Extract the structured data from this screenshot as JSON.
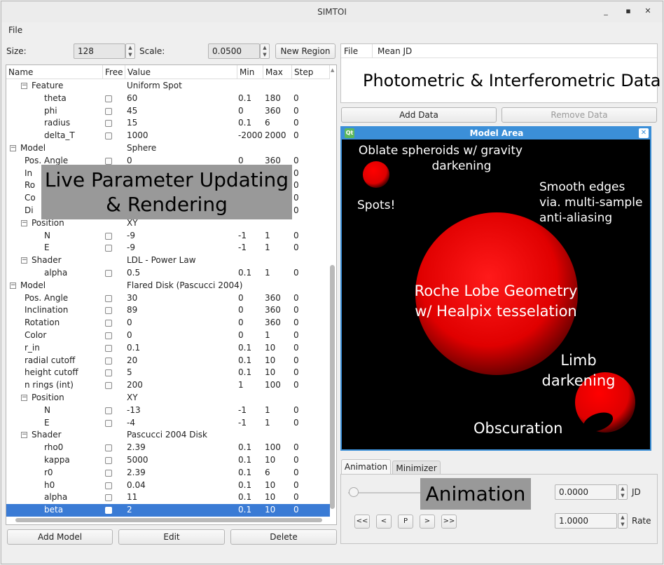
{
  "window": {
    "title": "SIMTOI"
  },
  "menu": {
    "file": "File"
  },
  "toolbar": {
    "size_label": "Size:",
    "size_value": "128",
    "scale_label": "Scale:",
    "scale_value": "0.0500",
    "new_region": "New Region"
  },
  "tree": {
    "headers": [
      "Name",
      "Free",
      "Value",
      "Min",
      "Max",
      "Step"
    ],
    "rows": [
      {
        "indent": 1,
        "exp": "−",
        "name": "Feature",
        "value": "Uniform Spot",
        "free": false,
        "min": "",
        "max": "",
        "step": ""
      },
      {
        "indent": 2,
        "name": "theta",
        "free": true,
        "value": "60",
        "min": "0.1",
        "max": "180",
        "step": "0"
      },
      {
        "indent": 2,
        "name": "phi",
        "free": true,
        "value": "45",
        "min": "0",
        "max": "360",
        "step": "0"
      },
      {
        "indent": 2,
        "name": "radius",
        "free": true,
        "value": "15",
        "min": "0.1",
        "max": "6",
        "step": "0"
      },
      {
        "indent": 2,
        "name": "delta_T",
        "free": true,
        "value": "1000",
        "min": "-2000",
        "max": "2000",
        "step": "0"
      },
      {
        "indent": 0,
        "exp": "−",
        "name": "Model",
        "value": "Sphere",
        "free": false,
        "min": "",
        "max": "",
        "step": ""
      },
      {
        "indent": 1,
        "name": "Pos. Angle",
        "free": true,
        "value": "0",
        "min": "0",
        "max": "360",
        "step": "0"
      },
      {
        "indent": 1,
        "name": "In",
        "free": true,
        "value": "",
        "min": "",
        "max": "",
        "step": "0"
      },
      {
        "indent": 1,
        "name": "Ro",
        "free": true,
        "value": "",
        "min": "",
        "max": "",
        "step": "0"
      },
      {
        "indent": 1,
        "name": "Co",
        "free": true,
        "value": "",
        "min": "",
        "max": "",
        "step": "0"
      },
      {
        "indent": 1,
        "name": "Di",
        "free": true,
        "value": "",
        "min": "",
        "max": "",
        "step": "0"
      },
      {
        "indent": 1,
        "exp": "−",
        "name": "Position",
        "value": "XY",
        "free": false,
        "min": "",
        "max": "",
        "step": ""
      },
      {
        "indent": 2,
        "name": "N",
        "free": true,
        "value": "-9",
        "min": "-1",
        "max": "1",
        "step": "0"
      },
      {
        "indent": 2,
        "name": "E",
        "free": true,
        "value": "-9",
        "min": "-1",
        "max": "1",
        "step": "0"
      },
      {
        "indent": 1,
        "exp": "−",
        "name": "Shader",
        "value": "LDL - Power Law",
        "free": false,
        "min": "",
        "max": "",
        "step": ""
      },
      {
        "indent": 2,
        "name": "alpha",
        "free": true,
        "value": "0.5",
        "min": "0.1",
        "max": "1",
        "step": "0"
      },
      {
        "indent": 0,
        "exp": "−",
        "name": "Model",
        "value": "Flared Disk (Pascucci 2004)",
        "free": false,
        "min": "",
        "max": "",
        "step": ""
      },
      {
        "indent": 1,
        "name": "Pos. Angle",
        "free": true,
        "value": "30",
        "min": "0",
        "max": "360",
        "step": "0"
      },
      {
        "indent": 1,
        "name": "Inclination",
        "free": true,
        "value": "89",
        "min": "0",
        "max": "360",
        "step": "0"
      },
      {
        "indent": 1,
        "name": "Rotation",
        "free": true,
        "value": "0",
        "min": "0",
        "max": "360",
        "step": "0"
      },
      {
        "indent": 1,
        "name": "Color",
        "free": true,
        "value": "0",
        "min": "0",
        "max": "1",
        "step": "0"
      },
      {
        "indent": 1,
        "name": "r_in",
        "free": true,
        "value": "0.1",
        "min": "0.1",
        "max": "10",
        "step": "0"
      },
      {
        "indent": 1,
        "name": "radial cutoff",
        "free": true,
        "value": "20",
        "min": "0.1",
        "max": "10",
        "step": "0"
      },
      {
        "indent": 1,
        "name": "height cutoff",
        "free": true,
        "value": "5",
        "min": "0.1",
        "max": "10",
        "step": "0"
      },
      {
        "indent": 1,
        "name": "n rings (int)",
        "free": true,
        "value": "200",
        "min": "1",
        "max": "100",
        "step": "0"
      },
      {
        "indent": 1,
        "exp": "−",
        "name": "Position",
        "value": "XY",
        "free": false,
        "min": "",
        "max": "",
        "step": ""
      },
      {
        "indent": 2,
        "name": "N",
        "free": true,
        "value": "-13",
        "min": "-1",
        "max": "1",
        "step": "0"
      },
      {
        "indent": 2,
        "name": "E",
        "free": true,
        "value": "-4",
        "min": "-1",
        "max": "1",
        "step": "0"
      },
      {
        "indent": 1,
        "exp": "−",
        "name": "Shader",
        "value": "Pascucci 2004 Disk",
        "free": false,
        "min": "",
        "max": "",
        "step": ""
      },
      {
        "indent": 2,
        "name": "rho0",
        "free": true,
        "value": "2.39",
        "min": "0.1",
        "max": "100",
        "step": "0"
      },
      {
        "indent": 2,
        "name": "kappa",
        "free": true,
        "value": "5000",
        "min": "0.1",
        "max": "10",
        "step": "0"
      },
      {
        "indent": 2,
        "name": "r0",
        "free": true,
        "value": "2.39",
        "min": "0.1",
        "max": "6",
        "step": "0"
      },
      {
        "indent": 2,
        "name": "h0",
        "free": true,
        "value": "0.04",
        "min": "0.1",
        "max": "10",
        "step": "0"
      },
      {
        "indent": 2,
        "name": "alpha",
        "free": true,
        "value": "11",
        "min": "0.1",
        "max": "10",
        "step": "0"
      },
      {
        "indent": 2,
        "name": "beta",
        "free": true,
        "value": "2",
        "min": "0.1",
        "max": "10",
        "step": "0",
        "selected": true
      }
    ]
  },
  "buttons": {
    "add_model": "Add Model",
    "edit": "Edit",
    "delete": "Delete",
    "add_data": "Add Data",
    "remove_data": "Remove Data"
  },
  "overlay_live": [
    "Live Parameter Updating",
    "& Rendering"
  ],
  "data_panel": {
    "col_file": "File",
    "col_meanjd": "Mean JD",
    "caption": "Photometric & Interferometric Data"
  },
  "model_area": {
    "title": "Model Area",
    "qt_badge": "Qt",
    "annotations": {
      "oblate": [
        "Oblate spheroids w/ gravity",
        "darkening"
      ],
      "spots": "Spots!",
      "smooth": [
        "Smooth edges",
        "via. multi-sample",
        "anti-aliasing"
      ],
      "roche": [
        "Roche Lobe Geometry",
        "w/ Healpix tesselation"
      ],
      "limb": [
        "Limb",
        "darkening"
      ],
      "obscuration": "Obscuration"
    }
  },
  "tabs": {
    "animation": "Animation",
    "minimizer": "Minimizer"
  },
  "animation": {
    "caption": "Animation",
    "jd_value": "0.0000",
    "jd_label": "JD",
    "rate_value": "1.0000",
    "rate_label": "Rate",
    "nav": [
      "<<",
      "<",
      "P",
      ">",
      ">>"
    ],
    "slider_fraction": 0
  },
  "colors": {
    "accent": "#3b8fd8",
    "selection": "#3a7bd5",
    "star": "#ff0000"
  }
}
